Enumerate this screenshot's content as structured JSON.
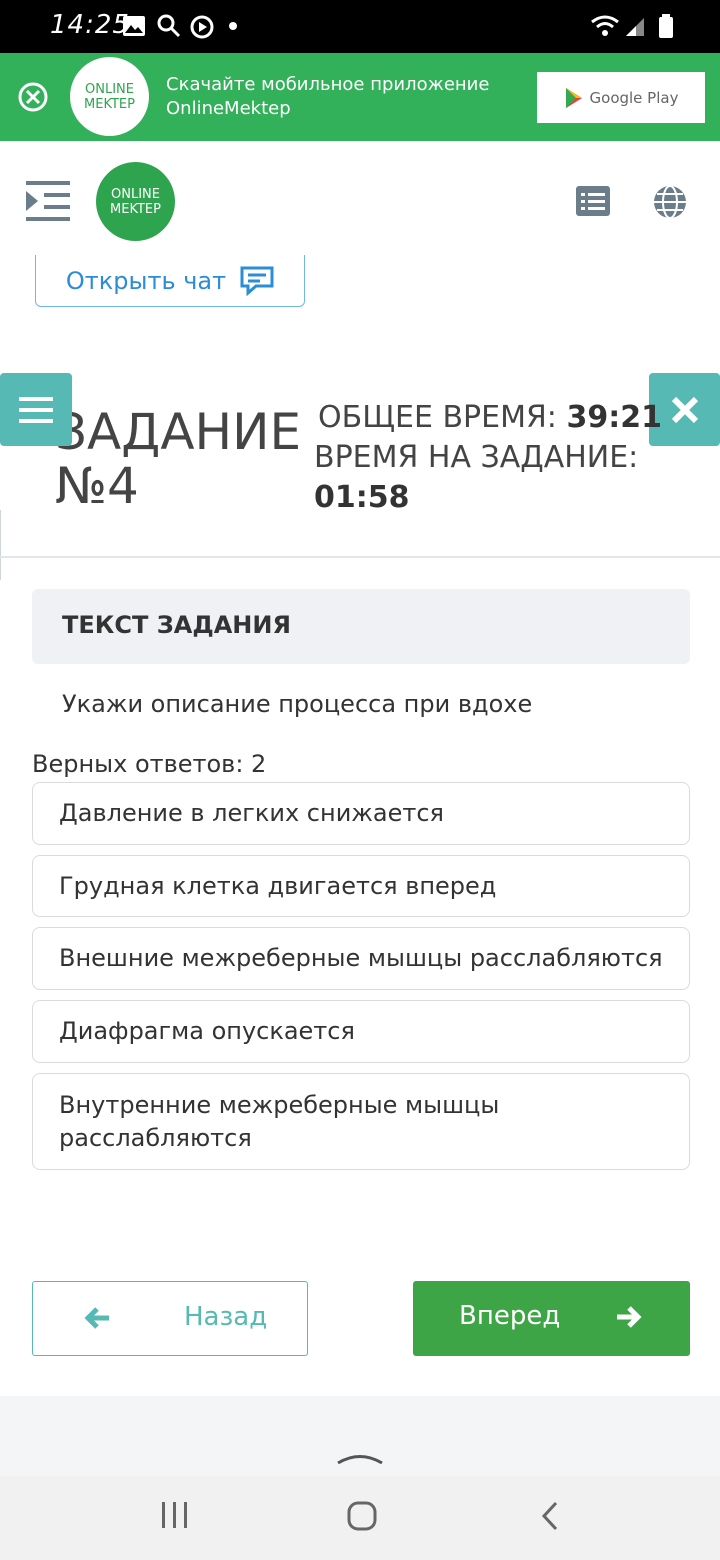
{
  "status_bar": {
    "time": "14:25"
  },
  "banner": {
    "logo_line1": "ONLINE",
    "logo_line2": "MEKTEP",
    "text_line1": "Скачайте мобильное приложение",
    "text_line2": "OnlineMektep",
    "store_label": "Google Play"
  },
  "header": {
    "logo_line1": "ONLINE",
    "logo_line2": "MEKTEP"
  },
  "chat": {
    "label": "Открыть чат"
  },
  "task": {
    "title_line1": "ЗАДАНИЕ",
    "title_line2": "№4",
    "total_time_label": "ОБЩЕЕ ВРЕМЯ:",
    "total_time": "39:21",
    "task_time_label": "ВРЕМЯ НА ЗАДАНИЕ:",
    "task_time": "01:58"
  },
  "card": {
    "heading": "ТЕКСТ ЗАДАНИЯ"
  },
  "question": "Укажи описание процесса при вдохе",
  "correct_count_label": "Верных ответов: 2",
  "options": [
    "Давление в легких снижается",
    "Грудная клетка двигается вперед",
    "Внешние межреберные мышцы расслабляются",
    "Диафрагма опускается",
    "Внутренние межреберные мышцы расслабляются"
  ],
  "buttons": {
    "back": "Назад",
    "next": "Вперед"
  },
  "colors": {
    "brand_green": "#32b05a",
    "teal": "#56b9b4",
    "next_green": "#3ea546",
    "link_blue": "#2b8cd8"
  }
}
